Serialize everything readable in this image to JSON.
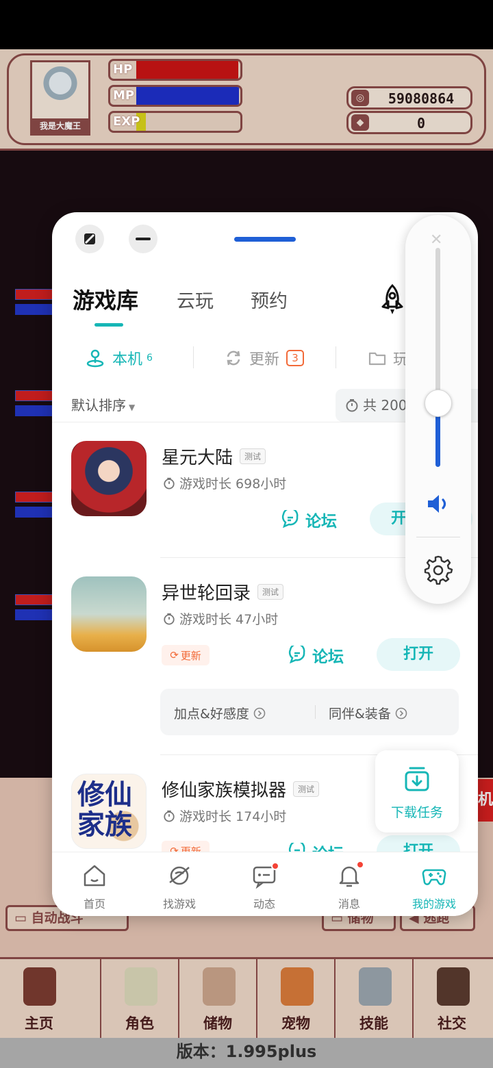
{
  "game": {
    "player_name": "我是大魔王",
    "stats": [
      {
        "label": "HP",
        "fill": 0.98,
        "color": "#c81414"
      },
      {
        "label": "MP",
        "fill": 0.99,
        "color": "#1e2fc8"
      },
      {
        "label": "EXP",
        "fill": 0.09,
        "color": "#d7d21c"
      }
    ],
    "coins": "59080864",
    "gems": "0",
    "buttons": {
      "auto_battle": "自动战斗",
      "storage": "储物",
      "escape": "逃跑"
    },
    "nav": [
      "主页",
      "角色",
      "储物",
      "宠物",
      "技能",
      "社交"
    ],
    "version": "版本：1.995plus",
    "side_label": "机"
  },
  "panel": {
    "main_tabs": {
      "library": "游戏库",
      "cloud": "云玩",
      "reserve": "预约"
    },
    "sub_tabs": {
      "local": "本机",
      "local_count": "6",
      "update": "更新",
      "update_count": "3",
      "played": "玩过"
    },
    "sort_label": "默认排序",
    "total_label": "共 2000+小时",
    "games": [
      {
        "title": "星元大陆",
        "tag": "测试",
        "play_time": "游戏时长 698小时",
        "forum": "论坛",
        "action": "开始游戏"
      },
      {
        "title": "异世轮回录",
        "tag": "测试",
        "play_time": "游戏时长 47小时",
        "update_tag": "更新",
        "forum": "论坛",
        "action": "打开",
        "guides": [
          "加点&好感度",
          "同伴&装备"
        ]
      },
      {
        "title": "修仙家族模拟器",
        "tag": "测试",
        "play_time": "游戏时长 174小时",
        "update_tag": "更新",
        "forum": "论坛",
        "action": "打开"
      }
    ],
    "download_label": "下载任务",
    "bottom_nav": [
      {
        "label": "首页",
        "icon": "home-icon"
      },
      {
        "label": "找游戏",
        "icon": "planet-icon"
      },
      {
        "label": "动态",
        "icon": "chat-icon"
      },
      {
        "label": "消息",
        "icon": "bell-icon"
      },
      {
        "label": "我的游戏",
        "icon": "gamepad-icon"
      }
    ],
    "accent": "#16b6b6"
  },
  "volume": {
    "level": 0.29,
    "accent": "#1f5fd6"
  }
}
